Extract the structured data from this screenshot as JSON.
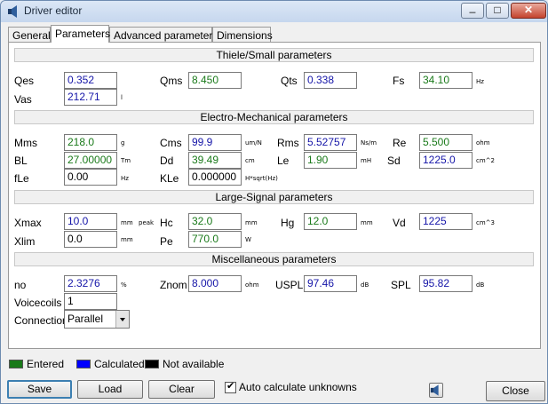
{
  "window": {
    "title": "Driver editor"
  },
  "tabs": [
    "General",
    "Parameters",
    "Advanced parameters",
    "Dimensions"
  ],
  "sections": {
    "ts": "Thiele/Small parameters",
    "em": "Electro-Mechanical parameters",
    "ls": "Large-Signal parameters",
    "misc": "Miscellaneous parameters"
  },
  "params": {
    "qes": {
      "label": "Qes",
      "value": "0.352",
      "unit": ""
    },
    "qms": {
      "label": "Qms",
      "value": "8.450",
      "unit": ""
    },
    "qts": {
      "label": "Qts",
      "value": "0.338",
      "unit": ""
    },
    "fs": {
      "label": "Fs",
      "value": "34.10",
      "unit": "Hz"
    },
    "vas": {
      "label": "Vas",
      "value": "212.71",
      "unit": "l"
    },
    "mms": {
      "label": "Mms",
      "value": "218.0",
      "unit": "g"
    },
    "cms": {
      "label": "Cms",
      "value": "99.9",
      "unit": "um/N"
    },
    "rms": {
      "label": "Rms",
      "value": "5.52757",
      "unit": "Ns/m"
    },
    "re": {
      "label": "Re",
      "value": "5.500",
      "unit": "ohm"
    },
    "bl": {
      "label": "BL",
      "value": "27.00000",
      "unit": "Tm"
    },
    "dd": {
      "label": "Dd",
      "value": "39.49",
      "unit": "cm"
    },
    "le": {
      "label": "Le",
      "value": "1.90",
      "unit": "mH"
    },
    "sd": {
      "label": "Sd",
      "value": "1225.0",
      "unit": "cm^2"
    },
    "fle": {
      "label": "fLe",
      "value": "0.00",
      "unit": "Hz"
    },
    "kle": {
      "label": "KLe",
      "value": "0.000000",
      "unit": "H*sqrt(Hz)"
    },
    "xmax": {
      "label": "Xmax",
      "value": "10.0",
      "unit": "mm",
      "extra": "peak"
    },
    "hc": {
      "label": "Hc",
      "value": "32.0",
      "unit": "mm"
    },
    "hg": {
      "label": "Hg",
      "value": "12.0",
      "unit": "mm"
    },
    "vd": {
      "label": "Vd",
      "value": "1225",
      "unit": "cm^3"
    },
    "xlim": {
      "label": "Xlim",
      "value": "0.0",
      "unit": "mm"
    },
    "pe": {
      "label": "Pe",
      "value": "770.0",
      "unit": "W"
    },
    "no": {
      "label": "no",
      "value": "2.3276",
      "unit": "%"
    },
    "znom": {
      "label": "Znom",
      "value": "8.000",
      "unit": "ohm"
    },
    "uspl": {
      "label": "USPL",
      "value": "97.46",
      "unit": "dB"
    },
    "spl": {
      "label": "SPL",
      "value": "95.82",
      "unit": "dB"
    },
    "voicecoils": {
      "label": "Voicecoils",
      "value": "1"
    }
  },
  "connection": {
    "label": "Connection",
    "value": "Parallel"
  },
  "legend": {
    "entered": "Entered",
    "calculated": "Calculated",
    "na": "Not available",
    "colors": {
      "entered": "#1a7a1a",
      "calculated": "#0000ff",
      "na": "#000000"
    }
  },
  "buttons": {
    "save": "Save",
    "load": "Load",
    "clear": "Clear",
    "auto_calc": "Auto calculate unknowns",
    "auto_calc_checked": "✔",
    "close": "Close"
  }
}
